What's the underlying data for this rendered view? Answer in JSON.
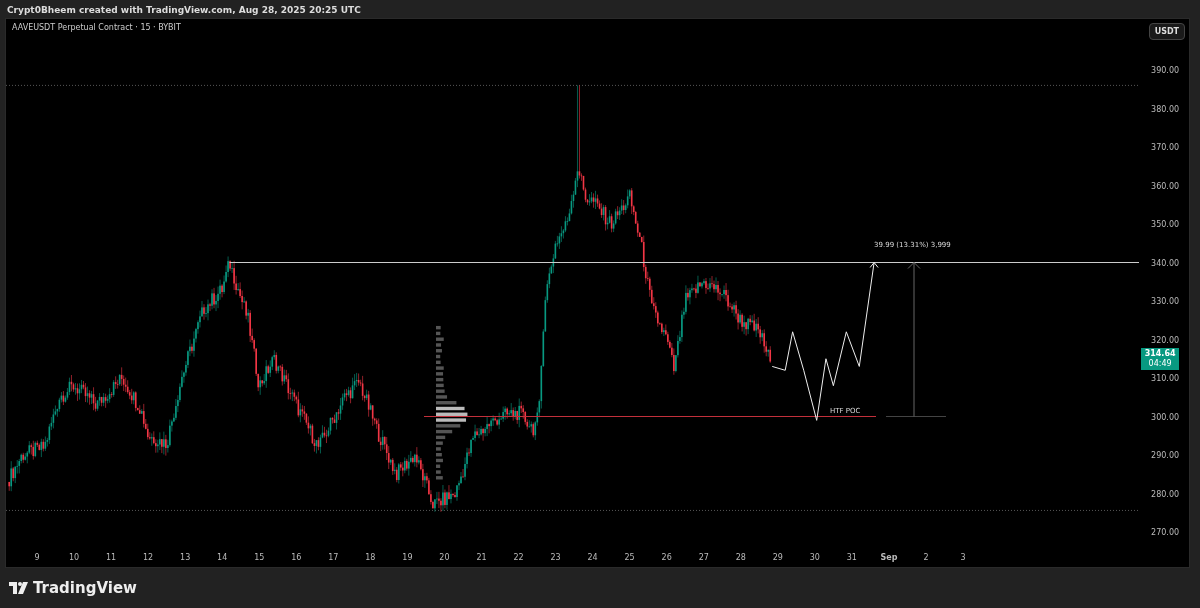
{
  "header": {
    "text": "Crypt0Bheem created with TradingView.com, Aug 28, 2025 20:25 UTC"
  },
  "chart": {
    "symbol": "AAVEUSDT Perpetual Contract · 15 · BYBIT",
    "currency_button": "USDT",
    "measure_label": "39.99 (13.31%) 3,999",
    "poc_label": "HTF POC"
  },
  "price_axis": {
    "labels": [
      "390.00",
      "380.00",
      "370.00",
      "360.00",
      "350.00",
      "340.00",
      "330.00",
      "320.00",
      "310.00",
      "300.00",
      "290.00",
      "280.00",
      "270.00"
    ],
    "current_price": {
      "price": "314.64",
      "countdown": "04:49"
    }
  },
  "time_axis": {
    "labels": [
      {
        "label": "9",
        "kind": "day"
      },
      {
        "label": "10",
        "kind": "day"
      },
      {
        "label": "11",
        "kind": "day"
      },
      {
        "label": "12",
        "kind": "day"
      },
      {
        "label": "13",
        "kind": "day"
      },
      {
        "label": "14",
        "kind": "day"
      },
      {
        "label": "15",
        "kind": "day"
      },
      {
        "label": "16",
        "kind": "day"
      },
      {
        "label": "17",
        "kind": "day"
      },
      {
        "label": "18",
        "kind": "day"
      },
      {
        "label": "19",
        "kind": "day"
      },
      {
        "label": "20",
        "kind": "day"
      },
      {
        "label": "21",
        "kind": "day"
      },
      {
        "label": "22",
        "kind": "day"
      },
      {
        "label": "23",
        "kind": "day"
      },
      {
        "label": "24",
        "kind": "day"
      },
      {
        "label": "25",
        "kind": "day"
      },
      {
        "label": "26",
        "kind": "day"
      },
      {
        "label": "27",
        "kind": "day"
      },
      {
        "label": "28",
        "kind": "day"
      },
      {
        "label": "29",
        "kind": "day"
      },
      {
        "label": "30",
        "kind": "day"
      },
      {
        "label": "31",
        "kind": "day"
      },
      {
        "label": "Sep",
        "kind": "month"
      },
      {
        "label": "2",
        "kind": "day"
      },
      {
        "label": "3",
        "kind": "day"
      }
    ]
  },
  "footer": {
    "logo_text": "TradingView"
  }
}
